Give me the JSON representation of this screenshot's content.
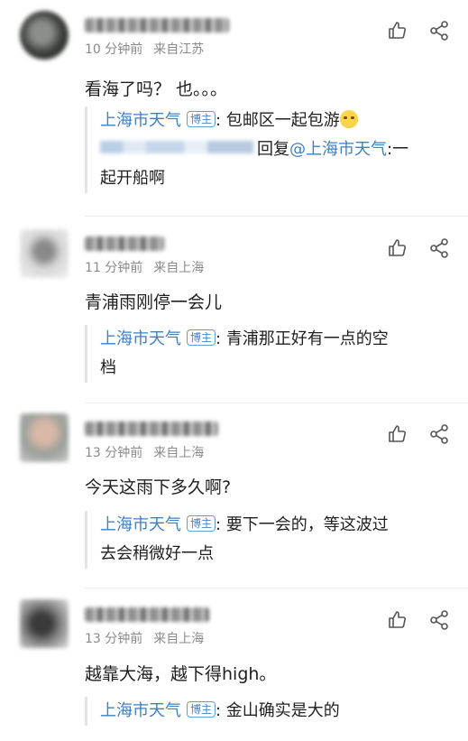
{
  "comments": [
    {
      "time": "10 分钟前",
      "location": "来自江苏",
      "text": "看海了吗？ 也。。。",
      "replies": [
        {
          "author": "上海市天气",
          "badge": "博主",
          "text": ": 包邮区一起包游"
        },
        {
          "reply_word": "回复",
          "mention": "@上海市天气",
          "text_line1": ":一",
          "text_line2": "起开船啊"
        }
      ]
    },
    {
      "time": "11 分钟前",
      "location": "来自上海",
      "text": "青浦雨刚停一会儿",
      "replies": [
        {
          "author": "上海市天气",
          "badge": "博主",
          "text_line1": ": 青浦那正好有一点的空",
          "text_line2": "档"
        }
      ]
    },
    {
      "time": "13 分钟前",
      "location": "来自上海",
      "text": "今天这雨下多久啊?",
      "replies": [
        {
          "author": "上海市天气",
          "badge": "博主",
          "text_line1": ": 要下一会的，等这波过",
          "text_line2": "去会稍微好一点"
        }
      ]
    },
    {
      "time": "13 分钟前",
      "location": "来自上海",
      "text": "越靠大海，越下得high。",
      "replies": [
        {
          "author": "上海市天气",
          "badge": "博主",
          "text": ": 金山确实是大的"
        }
      ]
    }
  ],
  "colors": {
    "accent": "#3f7fc4",
    "meta": "#8a8a8a",
    "divider": "#ececec"
  },
  "icons": [
    "like-icon",
    "share-icon",
    "crying-emoji-icon"
  ]
}
